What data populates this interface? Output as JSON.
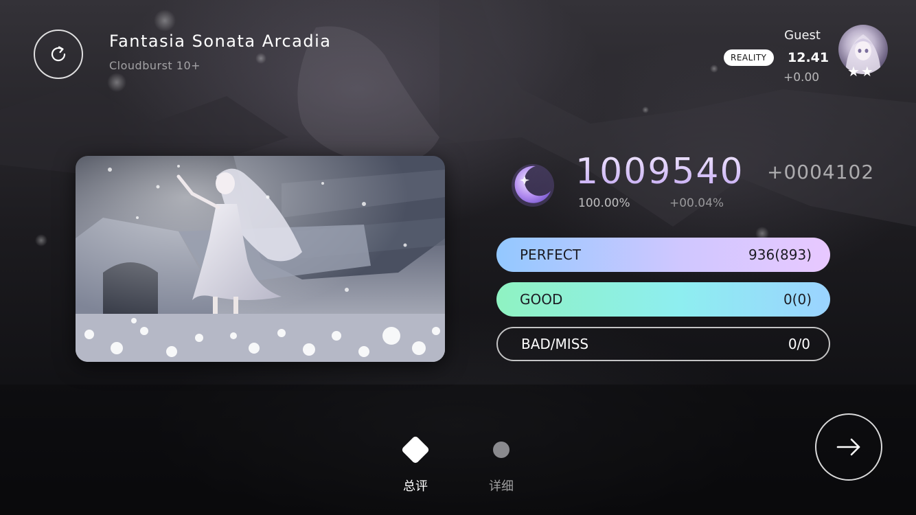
{
  "song": {
    "title": "Fantasia Sonata Arcadia",
    "difficulty": "Cloudburst 10+"
  },
  "player": {
    "name": "Guest",
    "badge": "REALITY",
    "rks": "12.41",
    "rks_delta": "+0.00",
    "stars": "★★"
  },
  "result": {
    "score": "1009540",
    "score_delta": "+0004102",
    "accuracy": "100.00%",
    "accuracy_delta": "+00.04%"
  },
  "judgements": [
    {
      "label": "PERFECT",
      "value": "936(893)"
    },
    {
      "label": "GOOD",
      "value": "0(0)"
    },
    {
      "label": "BAD/MISS",
      "value": "0/0"
    }
  ],
  "tabs": [
    {
      "label": "总评",
      "active": true
    },
    {
      "label": "详细",
      "active": false
    }
  ],
  "icons": {
    "retry": "retry-icon",
    "grade": "crescent-moon-icon",
    "next": "arrow-right-icon"
  },
  "colors": {
    "score": "#d9c6ff",
    "perfect_bar": "#cfc7ff",
    "good_bar": "#8eeef0"
  }
}
